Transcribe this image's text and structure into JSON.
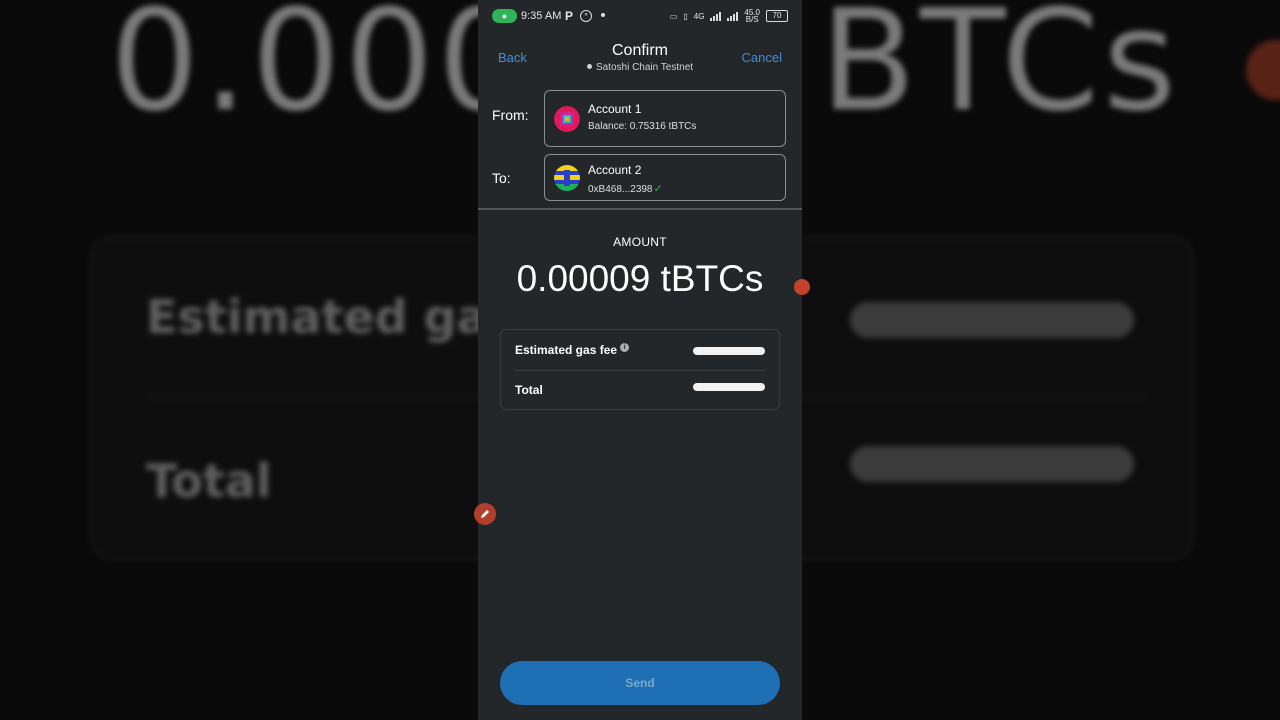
{
  "background": {
    "big_text_left": "0.000",
    "big_text_right": "BTCs",
    "label_gas": "Estimated gas",
    "label_total": "Total"
  },
  "status_bar": {
    "time": "9:35 AM",
    "p_indicator": "P",
    "network_4g": "4G",
    "speed": "45.0",
    "speed_unit": "B/S",
    "battery": "70"
  },
  "header": {
    "back_label": "Back",
    "title": "Confirm",
    "network": "Satoshi Chain Testnet",
    "cancel_label": "Cancel"
  },
  "from": {
    "label": "From:",
    "account_name": "Account 1",
    "balance": "Balance: 0.75316 tBTCs"
  },
  "to": {
    "label": "To:",
    "account_name": "Account 2",
    "address": "0xB468...2398"
  },
  "amount": {
    "label": "AMOUNT",
    "value": "0.00009 tBTCs"
  },
  "fees": {
    "gas_label": "Estimated gas fee",
    "total_label": "Total"
  },
  "send_label": "Send",
  "colors": {
    "accent": "#3f8fd8",
    "send_button": "#1e6fb3",
    "panel": "#24272a",
    "check": "#36b24a"
  }
}
